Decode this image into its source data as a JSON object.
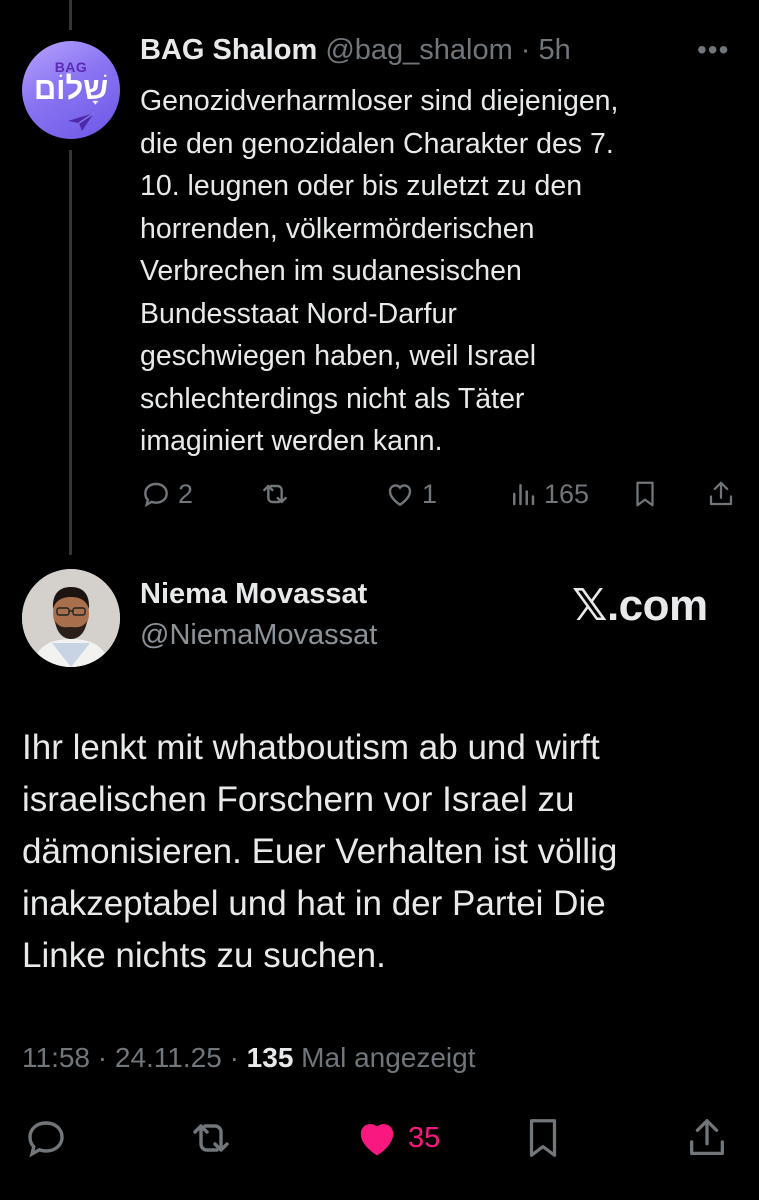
{
  "parent_tweet": {
    "avatar_label": "BAG",
    "avatar_hebrew": "שָׁלוֹם",
    "display_name": "BAG Shalom",
    "handle_time": "@bag_shalom · 5h",
    "more": "•••",
    "text_lines": [
      "Genozidverharmloser sind diejenigen,",
      "die den genozidalen Charakter des 7.",
      "10. leugnen oder bis zuletzt zu den",
      "horrenden, völkermörderischen",
      "Verbrechen im sudanesischen",
      "Bundesstaat Nord-Darfur",
      "geschwiegen haben, weil Israel",
      "schlechterdings nicht als Täter",
      "imaginiert werden kann."
    ],
    "replies": "2",
    "retweets": "",
    "likes": "1",
    "views": "165"
  },
  "reply_tweet": {
    "display_name": "Niema Movassat",
    "handle": "@NiemaMovassat",
    "watermark": "𝕏.com",
    "text_lines": [
      "Ihr lenkt mit whatboutism ab und wirft",
      "israelischen Forschern vor Israel zu",
      "dämonisieren. Euer Verhalten ist völlig",
      "inakzeptabel und hat in der Partei Die",
      "Linke nichts zu suchen."
    ],
    "time": "11:58 · 24.11.25 · ",
    "view_count": "135",
    "view_label": " Mal angezeigt",
    "likes": "35"
  },
  "colors": {
    "background": "#000000",
    "text": "#e7e9ea",
    "muted": "#71767b",
    "like": "#f91880",
    "thread_line": "#333639"
  },
  "icons": [
    "reply-icon",
    "retweet-icon",
    "like-icon",
    "views-icon",
    "bookmark-icon",
    "share-icon",
    "more-icon"
  ]
}
